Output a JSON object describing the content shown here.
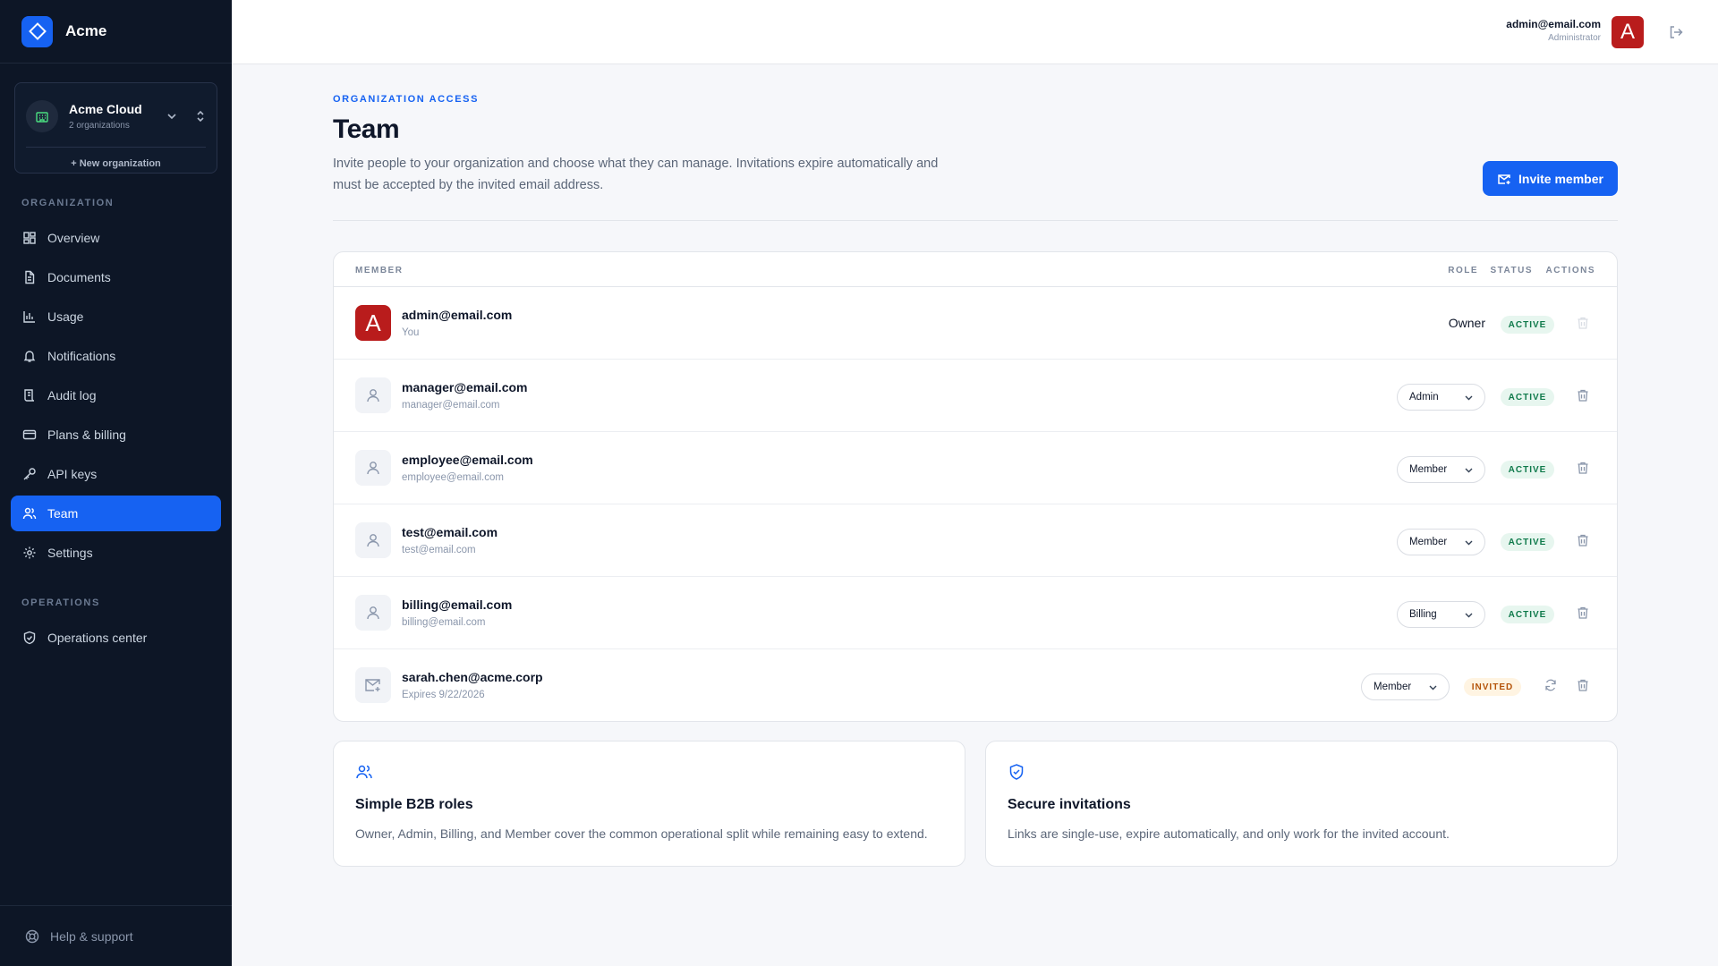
{
  "brand": {
    "name": "Acme"
  },
  "org_switcher": {
    "name": "Acme Cloud",
    "count": "2 organizations",
    "new_label": "+ New organization"
  },
  "sidebar": {
    "section_org": "ORGANIZATION",
    "section_ops": "OPERATIONS",
    "items": [
      {
        "label": "Overview",
        "icon": "grid-icon"
      },
      {
        "label": "Documents",
        "icon": "document-icon"
      },
      {
        "label": "Usage",
        "icon": "bar-chart-icon"
      },
      {
        "label": "Notifications",
        "icon": "bell-icon"
      },
      {
        "label": "Audit log",
        "icon": "scroll-icon"
      },
      {
        "label": "Plans & billing",
        "icon": "credit-card-icon"
      },
      {
        "label": "API keys",
        "icon": "key-icon"
      },
      {
        "label": "Team",
        "icon": "users-icon",
        "active": true
      },
      {
        "label": "Settings",
        "icon": "gear-icon"
      }
    ],
    "ops_items": [
      {
        "label": "Operations center",
        "icon": "shield-icon"
      }
    ],
    "footer": "Help & support"
  },
  "header": {
    "user_email": "admin@email.com",
    "user_role": "Administrator",
    "avatar_letter": "A"
  },
  "page": {
    "eyebrow": "ORGANIZATION ACCESS",
    "title": "Team",
    "description": "Invite people to your organization and choose what they can manage. Invitations expire automatically and must be accepted by the invited email address.",
    "invite_button": "Invite member"
  },
  "table": {
    "headers": {
      "member": "MEMBER",
      "role": "ROLE",
      "status": "STATUS",
      "actions": "ACTIONS"
    },
    "rows": [
      {
        "email": "admin@email.com",
        "sub": "You",
        "role": "Owner",
        "status": "ACTIVE",
        "avatar": "A"
      },
      {
        "email": "manager@email.com",
        "sub": "manager@email.com",
        "role": "Admin",
        "status": "ACTIVE"
      },
      {
        "email": "employee@email.com",
        "sub": "employee@email.com",
        "role": "Member",
        "status": "ACTIVE"
      },
      {
        "email": "test@email.com",
        "sub": "test@email.com",
        "role": "Member",
        "status": "ACTIVE"
      },
      {
        "email": "billing@email.com",
        "sub": "billing@email.com",
        "role": "Billing",
        "status": "ACTIVE"
      },
      {
        "email": "sarah.chen@acme.corp",
        "sub": "Expires 9/22/2026",
        "role": "Member",
        "status": "INVITED"
      }
    ]
  },
  "cards": [
    {
      "title": "Simple B2B roles",
      "desc": "Owner, Admin, Billing, and Member cover the common operational split while remaining easy to extend."
    },
    {
      "title": "Secure invitations",
      "desc": "Links are single-use, expire automatically, and only work for the invited account."
    }
  ],
  "colors": {
    "accent": "#1662f2",
    "sidebar_bg": "#0d1626",
    "avatar_red": "#b91c1c",
    "active_green": "#0f7a4b",
    "invited_amber": "#b45309"
  }
}
